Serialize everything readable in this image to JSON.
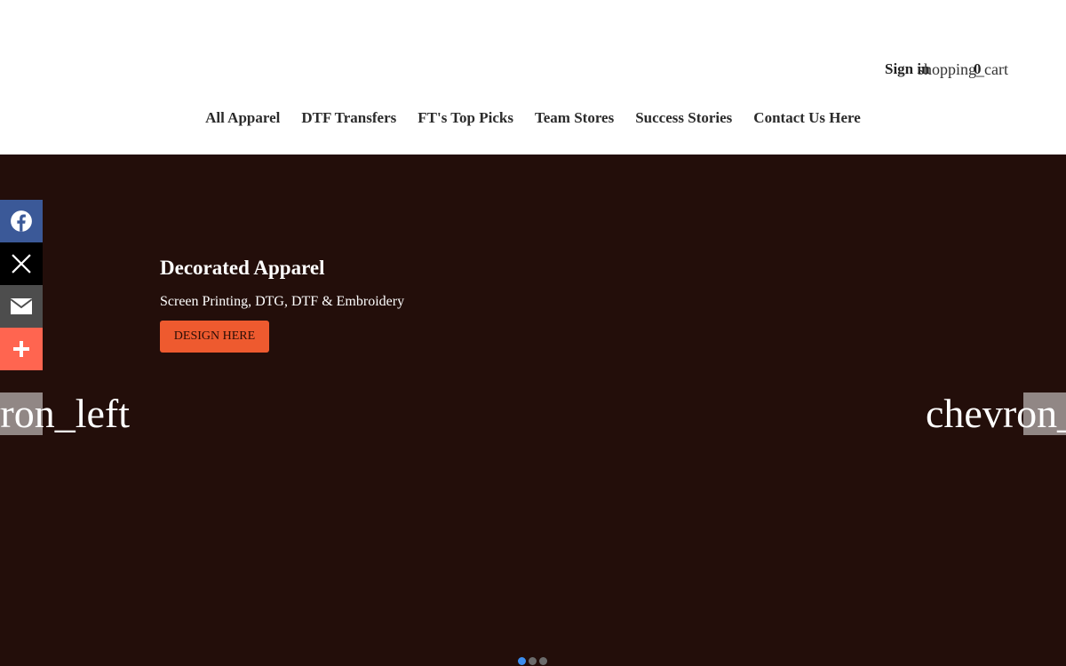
{
  "header": {
    "sign_in_label": "Sign in",
    "cart_icon_name": "shopping_cart",
    "cart_count": "0"
  },
  "nav": {
    "items": [
      {
        "label": "All Apparel"
      },
      {
        "label": "DTF Transfers"
      },
      {
        "label": "FT's Top Picks"
      },
      {
        "label": "Team Stores"
      },
      {
        "label": "Success Stories"
      },
      {
        "label": "Contact Us Here"
      }
    ]
  },
  "hero": {
    "title": "Decorated Apparel",
    "subtitle": "Screen Printing, DTG, DTF & Embroidery",
    "button_label": "DESIGN HERE",
    "arrow_left_text": "chevron_left",
    "arrow_right_text": "chevron_right",
    "background_color": "#230e0a",
    "button_color": "#ee5a2f",
    "slides": {
      "count": 3,
      "active_index": 0
    },
    "active_dot_color": "#3b8ef0"
  },
  "share": {
    "buttons": [
      {
        "icon": "facebook-icon",
        "color": "#3b5998"
      },
      {
        "icon": "x-icon",
        "color": "#000000"
      },
      {
        "icon": "email-icon",
        "color": "#4d4d4d"
      },
      {
        "icon": "plus-icon",
        "color": "#ff6550"
      }
    ]
  }
}
